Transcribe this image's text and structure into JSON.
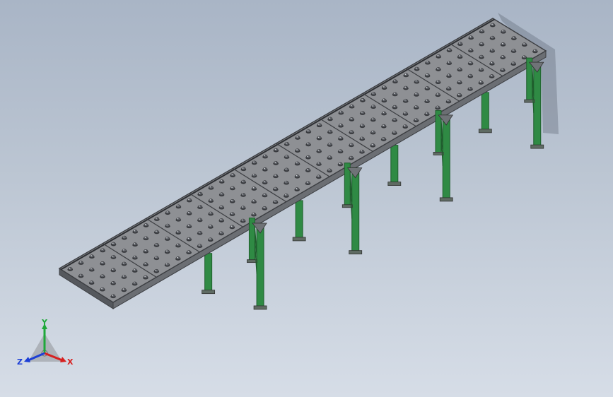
{
  "viewport": {
    "background_top": "#a9b5c6",
    "background_bottom": "#d6dde7"
  },
  "model": {
    "deck_color": "#8e9094",
    "deck_edge_color": "#3c3e42",
    "frame_color": "#2f8a44",
    "frame_dark": "#1f5e2d",
    "ball_color": "#5d6066",
    "module_count": 10,
    "ball_rows": 5,
    "balls_per_module_length": 4,
    "tall_leg_positions": [
      0.34,
      0.56,
      0.77,
      0.98
    ],
    "short_leg_positions": [
      0.22,
      0.43,
      0.65,
      0.86
    ]
  },
  "triad": {
    "x_label": "X",
    "y_label": "Y",
    "z_label": "Z",
    "x_color": "#d62020",
    "y_color": "#1fa83a",
    "z_color": "#1c3fd6"
  }
}
